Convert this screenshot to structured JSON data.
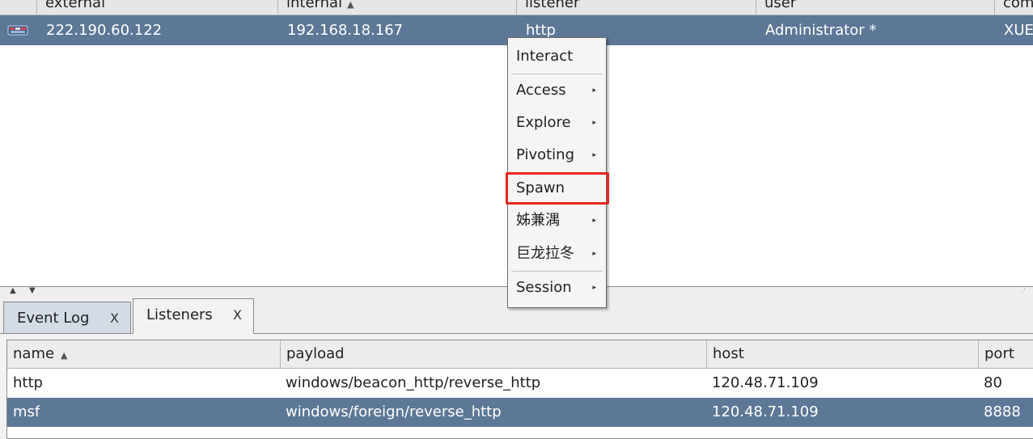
{
  "beacons_table": {
    "columns": [
      {
        "label": "external",
        "sort": ""
      },
      {
        "label": "internal",
        "sort": "▲"
      },
      {
        "label": "listener",
        "sort": ""
      },
      {
        "label": "user",
        "sort": ""
      },
      {
        "label": "com",
        "sort": ""
      }
    ],
    "rows": [
      {
        "icon": "beacon-session-icon",
        "external": "222.190.60.122",
        "internal": "192.168.18.167",
        "listener": "http",
        "user": "Administrator *",
        "computer": "XUE"
      }
    ],
    "selected_row_color": "#5d7896"
  },
  "divider": {
    "collapse_up": "▲",
    "collapse_down": "▼"
  },
  "tabs": [
    {
      "label": "Event Log",
      "close": "X",
      "active": false
    },
    {
      "label": "Listeners",
      "close": "X",
      "active": true
    }
  ],
  "listeners_table": {
    "columns": [
      {
        "label": "name",
        "sort": "▲"
      },
      {
        "label": "payload",
        "sort": ""
      },
      {
        "label": "host",
        "sort": ""
      },
      {
        "label": "port",
        "sort": ""
      }
    ],
    "rows": [
      {
        "name": "http",
        "payload": "windows/beacon_http/reverse_http",
        "host": "120.48.71.109",
        "port": "80",
        "selected": false
      },
      {
        "name": "msf",
        "payload": "windows/foreign/reverse_http",
        "host": "120.48.71.109",
        "port": "8888",
        "selected": true
      }
    ]
  },
  "context_menu": {
    "items": [
      {
        "label": "Interact",
        "submenu": false
      },
      {
        "label": "Access",
        "submenu": true
      },
      {
        "label": "Explore",
        "submenu": true
      },
      {
        "label": "Pivoting",
        "submenu": true
      },
      {
        "label": "Spawn",
        "submenu": false,
        "highlighted": true
      },
      {
        "label": "姊兼湡",
        "submenu": true
      },
      {
        "label": "巨龙拉冬",
        "submenu": true
      },
      {
        "label": "Session",
        "submenu": true
      }
    ],
    "submenu_arrow": "▸",
    "highlight_color": "#e8261e"
  }
}
